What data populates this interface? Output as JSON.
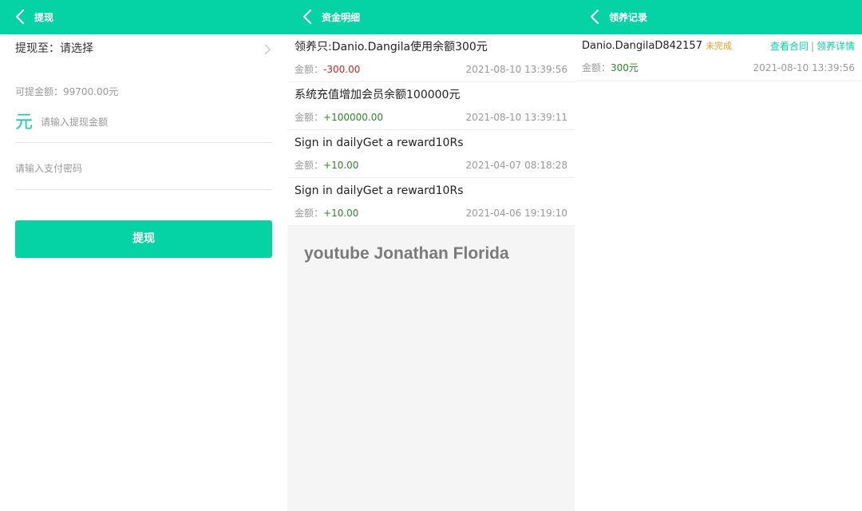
{
  "colors": {
    "accent": "#06d3a5",
    "negative": "#e02020",
    "positive": "#2c8a2c",
    "status_pending": "#f09a28"
  },
  "withdraw": {
    "title": "提现",
    "select_label": "提现至：请选择",
    "available": "可提金额：99700.00元",
    "currency_symbol": "元",
    "amount_placeholder": "请输入提现金额",
    "password_placeholder": "请输入支付密码",
    "submit_label": "提现"
  },
  "funds": {
    "title": "资金明细",
    "amount_prefix": "金额：",
    "items": [
      {
        "title": "领养只:Danio.Dangila使用余额300元",
        "amount": "-300.00",
        "time": "2021-08-10 13:39:56"
      },
      {
        "title": "系统充值增加会员余额100000元",
        "amount": "+100000.00",
        "time": "2021-08-10 13:39:11"
      },
      {
        "title": "Sign in dailyGet a reward10Rs",
        "amount": "+10.00",
        "time": "2021-04-07 08:18:28"
      },
      {
        "title": "Sign in dailyGet a reward10Rs",
        "amount": "+10.00",
        "time": "2021-04-06 19:19:10"
      }
    ],
    "watermark": "youtube Jonathan Florida"
  },
  "adopt": {
    "title": "领养记录",
    "items": [
      {
        "name": "Danio.DangilaD842157",
        "status": "未完成",
        "link_contract": "查看合同",
        "separator": "|",
        "link_details": "领养详情",
        "amount_prefix": "金额：",
        "amount": "300元",
        "time": "2021-08-10 13:39:56"
      }
    ]
  },
  "icons": {
    "back": "chevron-left-icon",
    "select": "chevron-right-icon"
  }
}
